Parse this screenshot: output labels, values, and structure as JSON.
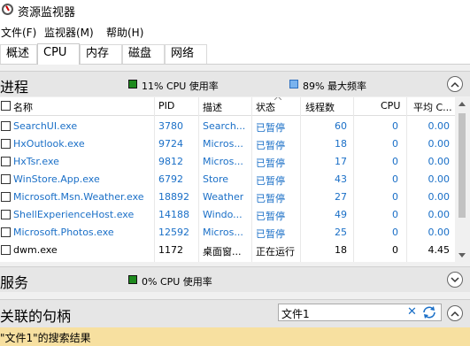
{
  "window": {
    "title": "资源监视器"
  },
  "menu": [
    "文件(F)",
    "监视器(M)",
    "帮助(H)"
  ],
  "tabs": [
    "概述",
    "CPU",
    "内存",
    "磁盘",
    "网络"
  ],
  "active_tab": "CPU",
  "processes_section": {
    "title": "进程",
    "cpu_stat": "11% CPU 使用率",
    "freq_stat": "89% 最大频率",
    "colors": {
      "cpu_square": "#1e8a1e",
      "freq_square": "#3b8fe0"
    }
  },
  "table": {
    "columns": [
      "名称",
      "PID",
      "描述",
      "状态",
      "线程数",
      "CPU",
      "平均 C..."
    ],
    "rows": [
      {
        "name": "SearchUI.exe",
        "pid": "3780",
        "desc": "Search...",
        "status": "已暂停",
        "threads": "60",
        "cpu": "0",
        "avg": "0.00",
        "blue": true
      },
      {
        "name": "HxOutlook.exe",
        "pid": "9724",
        "desc": "Micros...",
        "status": "已暂停",
        "threads": "18",
        "cpu": "0",
        "avg": "0.00",
        "blue": true
      },
      {
        "name": "HxTsr.exe",
        "pid": "9812",
        "desc": "Micros...",
        "status": "已暂停",
        "threads": "17",
        "cpu": "0",
        "avg": "0.00",
        "blue": true
      },
      {
        "name": "WinStore.App.exe",
        "pid": "6792",
        "desc": "Store",
        "status": "已暂停",
        "threads": "43",
        "cpu": "0",
        "avg": "0.00",
        "blue": true
      },
      {
        "name": "Microsoft.Msn.Weather.exe",
        "pid": "18892",
        "desc": "Weather",
        "status": "已暂停",
        "threads": "27",
        "cpu": "0",
        "avg": "0.00",
        "blue": true
      },
      {
        "name": "ShellExperienceHost.exe",
        "pid": "14188",
        "desc": "Windo...",
        "status": "已暂停",
        "threads": "49",
        "cpu": "0",
        "avg": "0.00",
        "blue": true
      },
      {
        "name": "Microsoft.Photos.exe",
        "pid": "12592",
        "desc": "Micros...",
        "status": "已暂停",
        "threads": "25",
        "cpu": "0",
        "avg": "0.00",
        "blue": true
      },
      {
        "name": "dwm.exe",
        "pid": "1172",
        "desc": "桌面窗...",
        "status": "正在运行",
        "threads": "18",
        "cpu": "0",
        "avg": "4.45",
        "blue": false
      }
    ]
  },
  "services_section": {
    "title": "服务",
    "cpu_stat": "0% CPU 使用率"
  },
  "handles_section": {
    "title": "关联的句柄",
    "search_value": "文件1"
  },
  "results_bar": {
    "text": "\"文件1\"的搜索结果"
  }
}
